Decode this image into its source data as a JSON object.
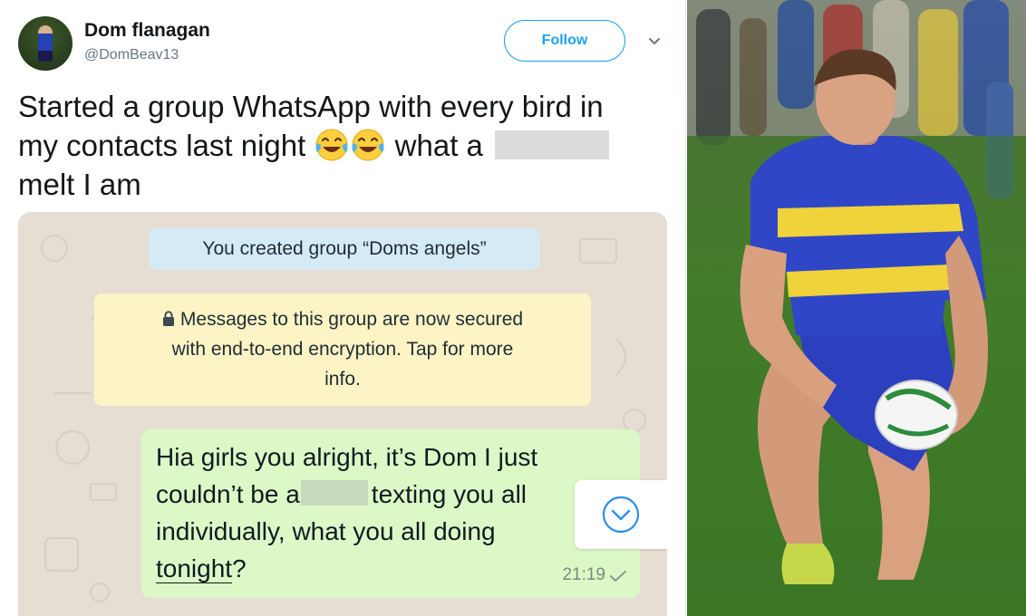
{
  "tweet": {
    "author_name": "Dom flanagan",
    "author_handle": "@DomBeav13",
    "follow_label": "Follow",
    "text_lines": [
      "Started a group WhatsApp with every bird in",
      "my contacts last night",
      "what a",
      "melt I am"
    ],
    "emoji": "face-with-tears-of-joy"
  },
  "whatsapp": {
    "system_created": "You created group “Doms angels”",
    "system_secure_lines": [
      "Messages to this group are now secured",
      "with end-to-end encryption. Tap for more",
      "info."
    ],
    "message": {
      "line1": "Hia girls you alright, it’s Dom I just",
      "line2a": "couldn’t be a",
      "line2b": "texting you all",
      "line3": "individually, what you all doing",
      "line4_underlined": "tonight",
      "line4_end": "?",
      "time": "21:19",
      "status_icon": "check-icon"
    },
    "bubble_color": "#dcf8c6",
    "created_banner_color": "#d4eaf4",
    "secure_banner_color": "#fdf4c5"
  },
  "colors": {
    "twitter_blue": "#1da1f2",
    "chat_background": "#e6ddd3"
  }
}
